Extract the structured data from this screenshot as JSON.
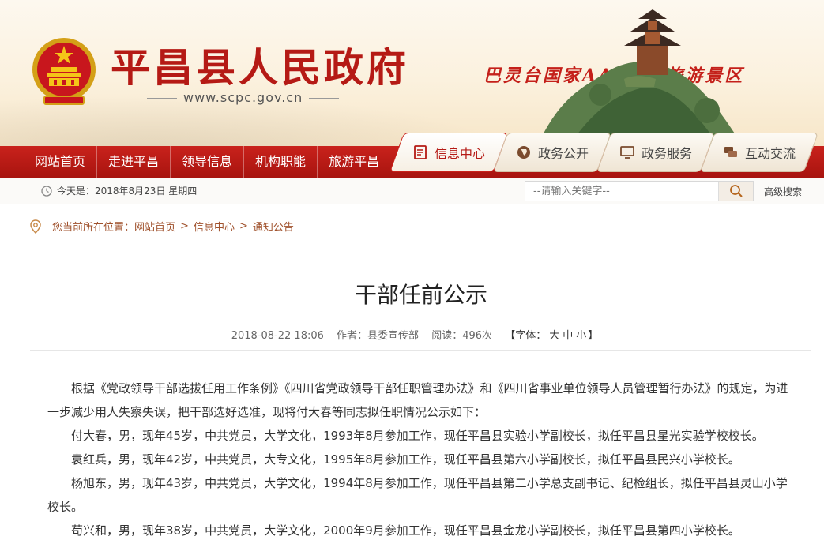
{
  "header": {
    "site_title": "平昌县人民政府",
    "site_url": "www.scpc.gov.cn",
    "scenic_slogan": "巴灵台国家AAAA级旅游景区"
  },
  "nav": {
    "items": [
      "网站首页",
      "走进平昌",
      "领导信息",
      "机构职能",
      "旅游平昌"
    ]
  },
  "tabs": [
    {
      "label": "信息中心",
      "icon": "document-icon",
      "active": true
    },
    {
      "label": "政务公开",
      "icon": "globe-icon",
      "active": false
    },
    {
      "label": "政务服务",
      "icon": "monitor-icon",
      "active": false
    },
    {
      "label": "互动交流",
      "icon": "chat-icon",
      "active": false
    }
  ],
  "toolbar": {
    "date_text": "今天是：2018年8月23日 星期四",
    "search_placeholder": "--请输入关键字--",
    "advanced_search": "高级搜索"
  },
  "breadcrumb": {
    "prefix": "您当前所在位置：",
    "items": [
      "网站首页",
      "信息中心",
      "通知公告"
    ],
    "separator": ">"
  },
  "article": {
    "title": "干部任前公示",
    "date": "2018-08-22 18:06",
    "author_label": "作者：",
    "author": "县委宣传部",
    "views_label": "阅读：",
    "views": "496次",
    "font_label": "【字体：",
    "font_sizes": [
      "大",
      "中",
      "小"
    ],
    "font_end": "】",
    "paragraphs": [
      "根据《党政领导干部选拔任用工作条例》《四川省党政领导干部任职管理办法》和《四川省事业单位领导人员管理暂行办法》的规定，为进一步减少用人失察失误，把干部选好选准，现将付大春等同志拟任职情况公示如下：",
      "付大春，男，现年45岁，中共党员，大学文化，1993年8月参加工作，现任平昌县实验小学副校长，拟任平昌县星光实验学校校长。",
      "袁红兵，男，现年42岁，中共党员，大专文化，1995年8月参加工作，现任平昌县第六小学副校长，拟任平昌县民兴小学校长。",
      "杨旭东，男，现年43岁，中共党员，大学文化，1994年8月参加工作，现任平昌县第二小学总支副书记、纪检组长，拟任平昌县灵山小学校长。",
      "苟兴和，男，现年38岁，中共党员，大学文化，2000年9月参加工作，现任平昌县金龙小学副校长，拟任平昌县第四小学校长。"
    ]
  },
  "colors": {
    "brand_red": "#b51a15",
    "nav_red": "#c9221c",
    "breadcrumb": "#a0522d"
  }
}
